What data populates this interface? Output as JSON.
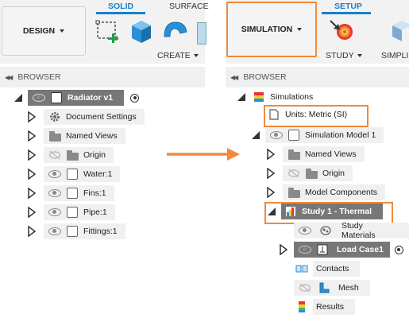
{
  "left": {
    "workspace_label": "DESIGN",
    "tabs": {
      "solid": "SOLID",
      "surface": "SURFACE"
    },
    "create_label": "CREATE",
    "browser_label": "BROWSER",
    "tree": [
      {
        "label": "Radiator v1"
      },
      {
        "label": "Document Settings"
      },
      {
        "label": "Named Views"
      },
      {
        "label": "Origin"
      },
      {
        "label": "Water:1"
      },
      {
        "label": "Fins:1"
      },
      {
        "label": "Pipe:1"
      },
      {
        "label": "Fittings:1"
      }
    ]
  },
  "right": {
    "workspace_label": "SIMULATION",
    "tabs": {
      "setup": "SETUP"
    },
    "study_label": "STUDY",
    "simplify_label": "SIMPLIF",
    "browser_label": "BROWSER",
    "tree": [
      {
        "label": "Simulations"
      },
      {
        "label": "Units: Metric (SI)"
      },
      {
        "label": "Simulation Model 1"
      },
      {
        "label": "Named Views"
      },
      {
        "label": "Origin"
      },
      {
        "label": "Model Components"
      },
      {
        "label": "Study 1 - Thermal"
      },
      {
        "label": "Study Materials"
      },
      {
        "label": "Load Case1"
      },
      {
        "label": "Contacts"
      },
      {
        "label": "Mesh"
      },
      {
        "label": "Results"
      }
    ]
  },
  "colors": {
    "highlight": "#f08a3c",
    "accent": "#1a80c4",
    "arrow": "#f08a3c"
  }
}
